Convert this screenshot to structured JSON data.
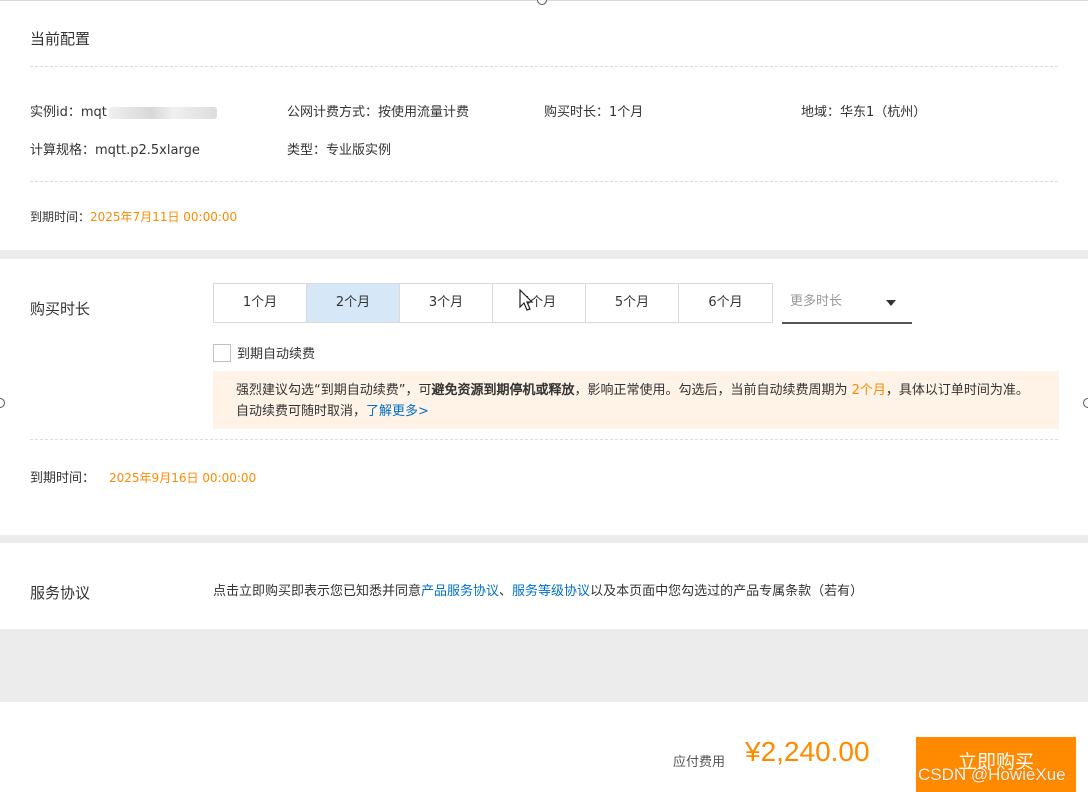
{
  "config": {
    "title": "当前配置",
    "instance_id_label": "实例id：",
    "instance_id_value": "mqt",
    "billing_label": "公网计费方式：",
    "billing_value": "按使用流量计费",
    "duration_label": "购买时长：",
    "duration_value": "1个月",
    "region_label": "地域：",
    "region_value": "华东1（杭州）",
    "spec_label": "计算规格：",
    "spec_value": "mqtt.p2.5xlarge",
    "type_label": "类型：",
    "type_value": "专业版实例",
    "expire_label": "到期时间：",
    "expire_value": "2025年7月11日 00:00:00"
  },
  "purchase": {
    "label": "购买时长",
    "options": [
      "1个月",
      "2个月",
      "3个月",
      "4个月",
      "5个月",
      "6个月"
    ],
    "selected_index": 1,
    "more_placeholder": "更多时长",
    "auto_renew_label": "到期自动续费",
    "tip_part1": "强烈建议勾选“到期自动续费”，可",
    "tip_bold": "避免资源到期停机或释放",
    "tip_part2": "，影响正常使用。勾选后，当前自动续费周期为 ",
    "tip_period": "2个月",
    "tip_part3": "，具体以订单时间为准。自动续费可随时取消，",
    "tip_link": "了解更多>",
    "expire_label": "到期时间：",
    "expire_value": "2025年9月16日 00:00:00"
  },
  "agreement": {
    "label": "服务协议",
    "text1": "点击立即购买即表示您已知悉并同意",
    "link1": "产品服务协议",
    "sep": "、",
    "link2": "服务等级协议",
    "text2": "以及本页面中您勾选过的产品专属条款（若有）"
  },
  "footer": {
    "fee_label": "应付费用",
    "fee_amount": "¥2,240.00",
    "buy_label": "立即购买"
  },
  "watermark": "CSDN @HowieXue",
  "colors": {
    "accent": "#ff8a00",
    "link": "#0070cc",
    "selected_tab": "#d6e8f7",
    "tip_bg": "#fef3e6"
  }
}
